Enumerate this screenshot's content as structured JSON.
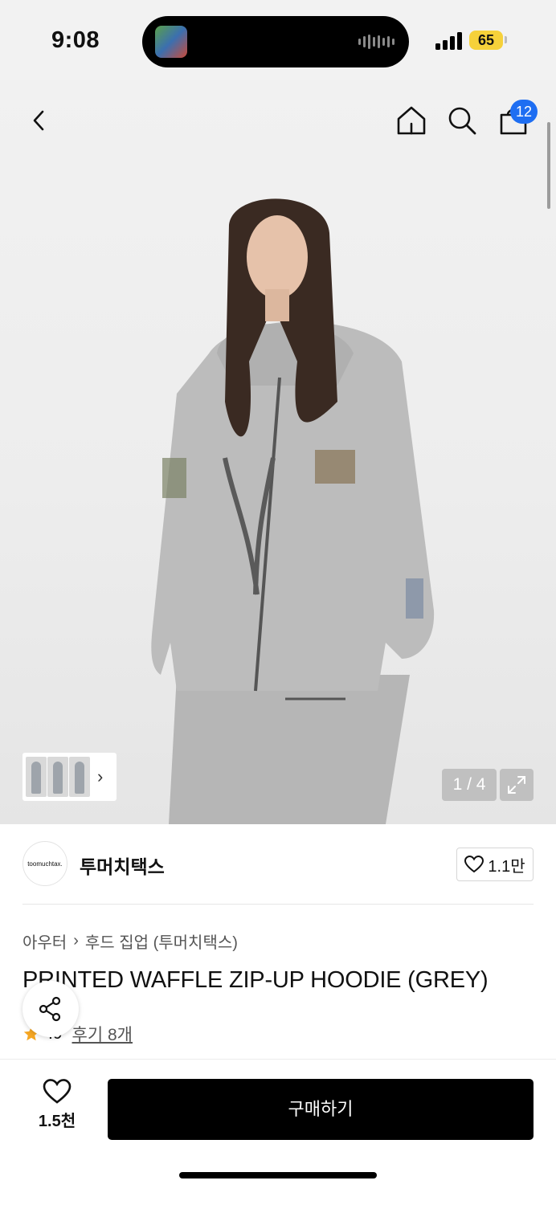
{
  "status_bar": {
    "time": "9:08",
    "battery": "65"
  },
  "header": {
    "cart_count": "12"
  },
  "gallery": {
    "counter": "1 / 4"
  },
  "brand": {
    "logo_text": "toomuchtax.",
    "name": "투머치택스",
    "like_count": "1.1만"
  },
  "breadcrumb": {
    "category": "아우터",
    "subcategory": "후드 집업 (투머치택스)"
  },
  "product": {
    "title": "PRINTED WAFFLE ZIP-UP HOODIE (GREY)",
    "rating": ".9",
    "review_link": "후기 8개"
  },
  "bottom_bar": {
    "favorite_count": "1.5천",
    "buy_label": "구매하기"
  },
  "colors": {
    "accent_badge": "#1e6ef2",
    "battery": "#f6d13a",
    "star": "#f5a623"
  },
  "icons": [
    "back-icon",
    "home-icon",
    "search-icon",
    "shopping-bag-icon",
    "expand-icon",
    "heart-icon",
    "share-icon",
    "star-icon",
    "chevron-right-icon"
  ]
}
